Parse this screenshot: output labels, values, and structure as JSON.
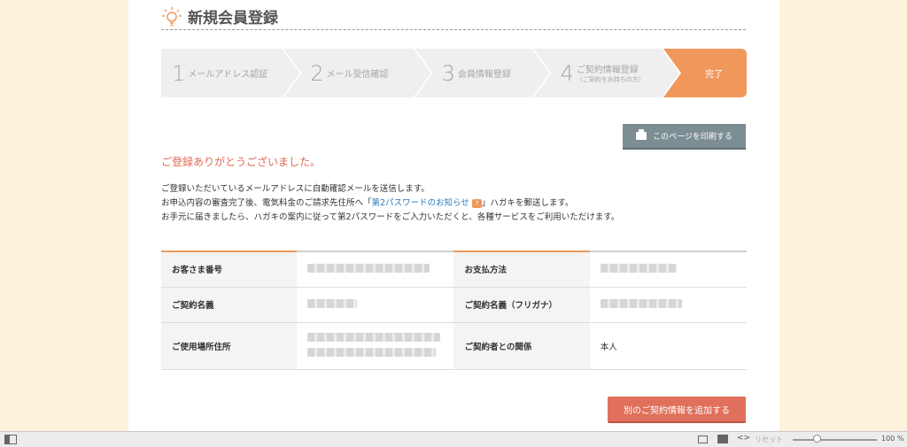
{
  "header": {
    "title": "新規会員登録"
  },
  "steps": [
    {
      "num": "1",
      "label": "メールアドレス認証"
    },
    {
      "num": "2",
      "label": "メール受信確認"
    },
    {
      "num": "3",
      "label": "会員情報登録"
    },
    {
      "num": "4",
      "label": "ご契約情報登録",
      "sub": "（ご契約をお持ちの方）"
    },
    {
      "label": "完了"
    }
  ],
  "print_button": "このページを印刷する",
  "thanks": "ご登録ありがとうございました。",
  "message": {
    "line1": "ご登録いただいているメールアドレスに自動確認メールを送信します。",
    "line2_pre": "お申込内容の審査完了後、電気料金のご請求先住所へ「",
    "line2_link": "第2パスワードのお知らせ",
    "line2_icon": "?",
    "line2_post": "」ハガキを郵送します。",
    "line3": "お手元に届きましたら、ハガキの案内に従って第2パスワードをご入力いただくと、各種サービスをご利用いただけます。"
  },
  "info_table": {
    "customer_number_label": "お客さま番号",
    "payment_method_label": "お支払方法",
    "contract_name_label": "ご契約名義",
    "contract_name_kana_label": "ご契約名義（フリガナ）",
    "address_label": "ご使用場所住所",
    "relation_label": "ご契約者との関係",
    "relation_value": "本人"
  },
  "add_button": "別のご契約情報を追加する",
  "statusbar": {
    "reset": "リセット",
    "zoom": "100 %"
  }
}
